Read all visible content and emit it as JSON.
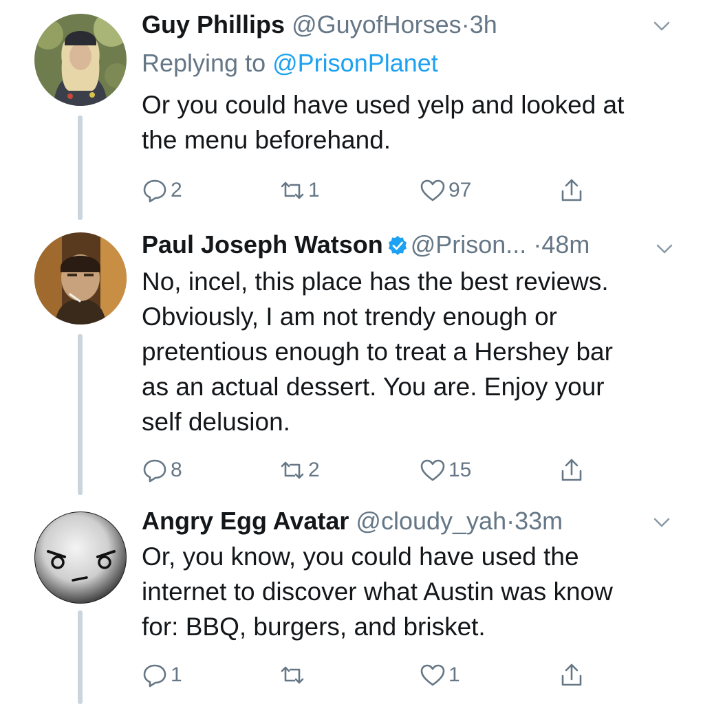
{
  "tweets": [
    {
      "name": "Guy Phillips",
      "handle": "@GuyofHorses",
      "sep": "·",
      "time": "3h",
      "verified": false,
      "replying_label": "Replying to",
      "replying_mention": "@PrisonPlanet",
      "lines": [
        "Or you could have used yelp and looked at",
        "the menu beforehand."
      ],
      "reply_count": "2",
      "retweet_count": "1",
      "like_count": "97"
    },
    {
      "name": "Paul Joseph Watson",
      "handle": "@Prison...",
      "sep": "·",
      "time": "48m",
      "verified": true,
      "lines": [
        "No, incel, this place has the best reviews.",
        "Obviously, I am not trendy enough or",
        "pretentious enough to treat a Hershey bar",
        "as an actual dessert. You are. Enjoy your",
        "self delusion."
      ],
      "reply_count": "8",
      "retweet_count": "2",
      "like_count": "15"
    },
    {
      "name": "Angry Egg Avatar",
      "handle": "@cloudy_yah",
      "sep": "·",
      "time": "33m",
      "verified": false,
      "lines": [
        "Or, you know, you could have used the",
        "internet to discover what Austin was know",
        "for: BBQ, burgers, and brisket."
      ],
      "reply_count": "1",
      "retweet_count": "",
      "like_count": "1"
    }
  ],
  "colors": {
    "text": "#14171a",
    "secondary": "#657786",
    "link": "#1da1f2",
    "thread_line": "#cbd5dd"
  },
  "icons": [
    "chevron-down-icon",
    "verified-badge-icon",
    "reply-icon",
    "retweet-icon",
    "like-icon",
    "share-icon"
  ]
}
